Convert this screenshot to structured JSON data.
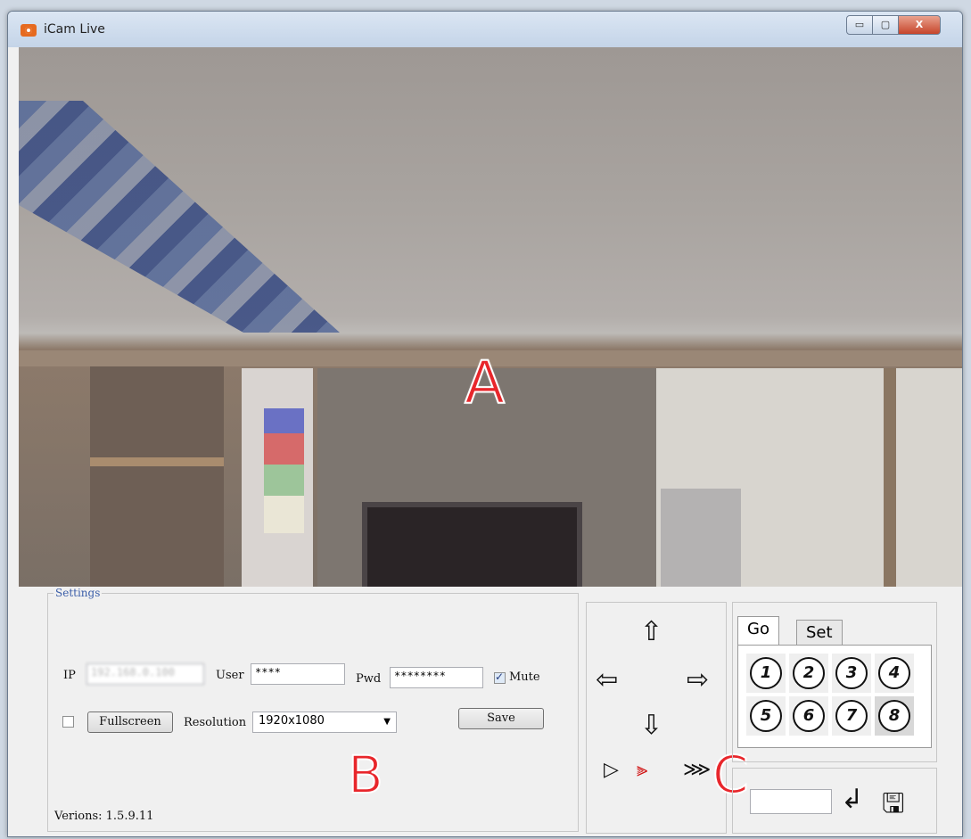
{
  "window": {
    "title": "iCam Live",
    "controls": {
      "minimize": "▭",
      "maximize": "▢",
      "close": "X"
    }
  },
  "overlays": {
    "a": "A",
    "b": "B",
    "c": "C"
  },
  "settings": {
    "legend": "Settings",
    "ip_label": "IP",
    "ip_value": "192.168.0.100",
    "user_label": "User",
    "user_value": "****",
    "pwd_label": "Pwd",
    "pwd_value": "********",
    "mute_label": "Mute",
    "mute_checked": true,
    "fullscreen_checked": false,
    "fullscreen_label": "Fullscreen",
    "resolution_label": "Resolution",
    "resolution_value": "1920x1080",
    "save_label": "Save",
    "version": "Verions: 1.5.9.11"
  },
  "ptz": {
    "icons": {
      "up": "arrow-up-icon",
      "down": "arrow-down-icon",
      "left": "arrow-left-icon",
      "right": "arrow-right-icon"
    },
    "speed_icons": [
      "speed-slow-icon",
      "speed-medium-icon",
      "speed-fast-icon"
    ],
    "active_speed": 2
  },
  "presets": {
    "tabs": [
      "Go",
      "Set"
    ],
    "active_tab": "Go",
    "buttons": [
      "1",
      "2",
      "3",
      "4",
      "5",
      "6",
      "7",
      "8"
    ],
    "selected": "8"
  },
  "bottom": {
    "input_value": "",
    "icons": [
      "enter-icon",
      "save-disk-icon"
    ]
  }
}
